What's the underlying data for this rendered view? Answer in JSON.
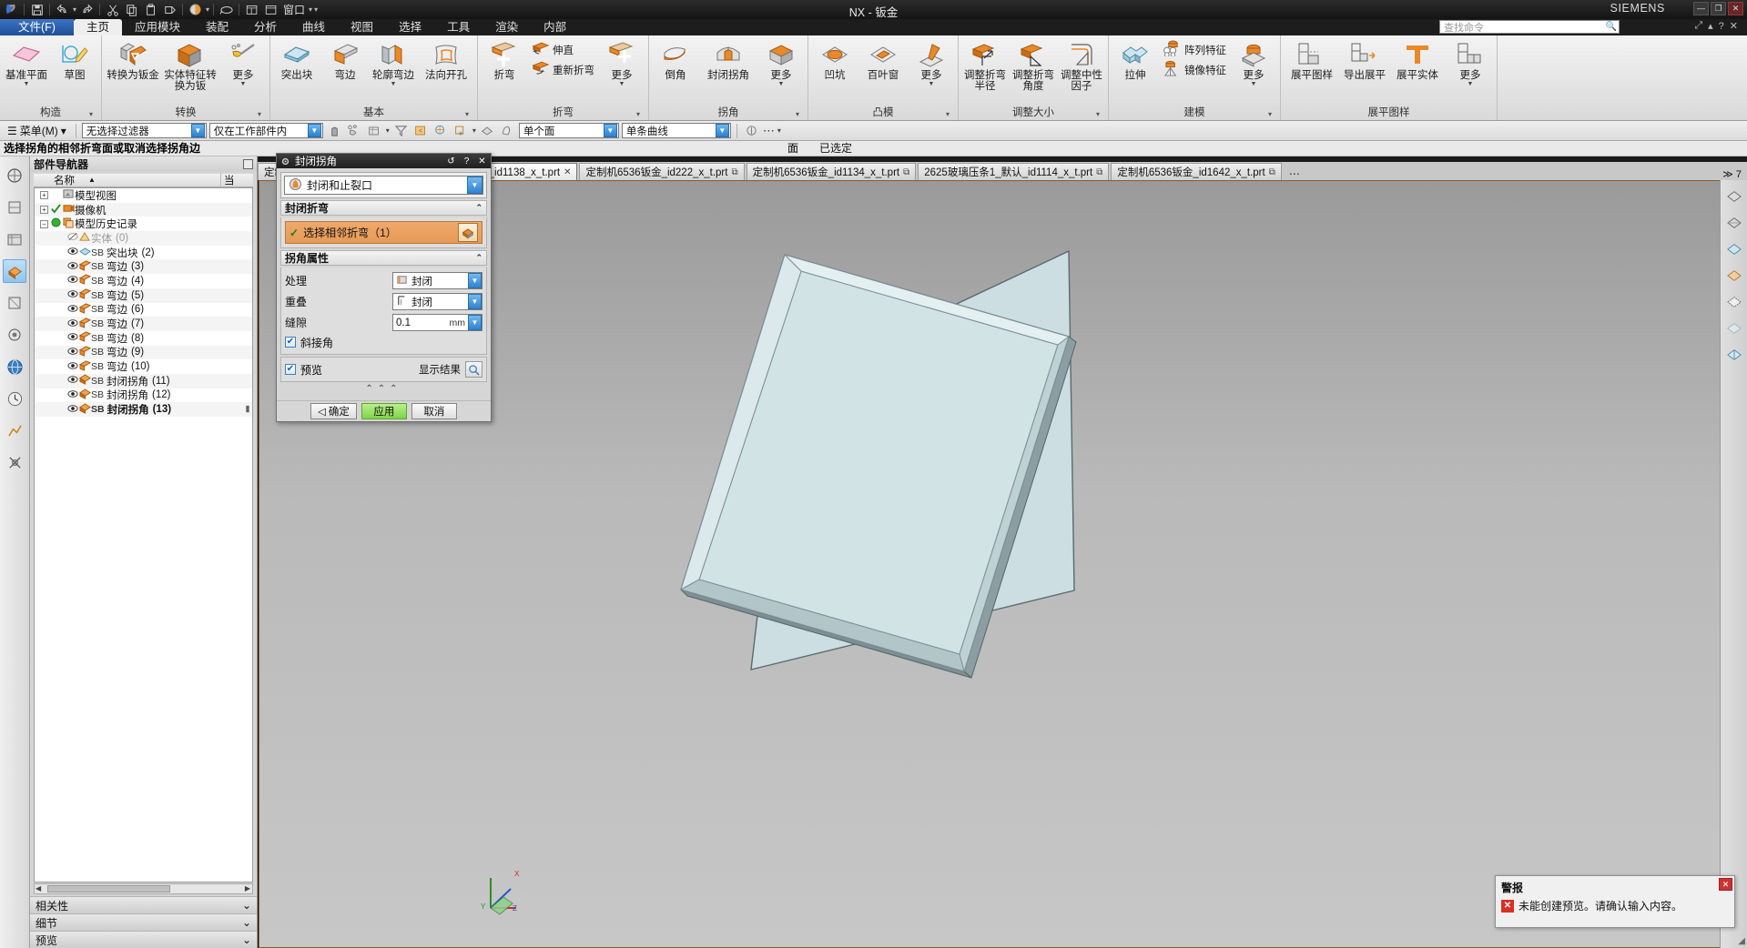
{
  "titlebar": {
    "title": "NX - 钣金",
    "brand": "SIEMENS",
    "min": "—",
    "max": "❐",
    "close": "✕"
  },
  "quick_access": {
    "window_label": "窗口",
    "caret": "▾",
    "more": "▾"
  },
  "search": {
    "placeholder": "查找命令"
  },
  "ribbon_tabs": [
    {
      "label": "文件(F)",
      "state": "file"
    },
    {
      "label": "主页",
      "state": "active"
    },
    {
      "label": "应用模块",
      "state": "normal"
    },
    {
      "label": "装配",
      "state": "normal"
    },
    {
      "label": "分析",
      "state": "normal"
    },
    {
      "label": "曲线",
      "state": "normal"
    },
    {
      "label": "视图",
      "state": "normal"
    },
    {
      "label": "选择",
      "state": "normal"
    },
    {
      "label": "工具",
      "state": "normal"
    },
    {
      "label": "渲染",
      "state": "normal"
    },
    {
      "label": "内部",
      "state": "normal"
    }
  ],
  "ribbon_groups": [
    {
      "label": "构造",
      "items": [
        {
          "label": "基准平面",
          "icon": "datum-plane-icon",
          "dropdown": true
        },
        {
          "label": "草图",
          "icon": "sketch-icon",
          "dropdown": false
        }
      ]
    },
    {
      "label": "转换",
      "items": [
        {
          "label": "转换为钣金",
          "icon": "convert-sheetmetal-icon",
          "dropdown": false
        },
        {
          "label": "实体特征转换为钣",
          "icon": "solid-to-sheet-icon",
          "dropdown": false
        },
        {
          "label": "更多",
          "icon": "more-icon",
          "dropdown": true
        }
      ]
    },
    {
      "label": "基本",
      "items": [
        {
          "label": "突出块",
          "icon": "tab-icon",
          "dropdown": false
        },
        {
          "label": "弯边",
          "icon": "flange-icon",
          "dropdown": false
        },
        {
          "label": "轮廓弯边",
          "icon": "contour-flange-icon",
          "dropdown": true
        },
        {
          "label": "法向开孔",
          "icon": "normal-cutout-icon",
          "dropdown": false
        }
      ]
    },
    {
      "label": "折弯",
      "items": [
        {
          "label": "折弯",
          "icon": "bend-icon",
          "dropdown": false
        },
        {
          "label": "伸直",
          "icon": "unbend-icon",
          "dropdown": false
        },
        {
          "label": "重新折弯",
          "icon": "rebend-icon",
          "dropdown": false
        },
        {
          "label": "更多",
          "icon": "more-icon",
          "dropdown": true
        }
      ]
    },
    {
      "label": "拐角",
      "items": [
        {
          "label": "倒角",
          "icon": "chamfer-icon",
          "dropdown": false
        },
        {
          "label": "封闭拐角",
          "icon": "closed-corner-icon",
          "dropdown": false
        },
        {
          "label": "更多",
          "icon": "more-icon",
          "dropdown": true
        }
      ]
    },
    {
      "label": "凸模",
      "items": [
        {
          "label": "凹坑",
          "icon": "dimple-icon",
          "dropdown": false
        },
        {
          "label": "百叶窗",
          "icon": "louver-icon",
          "dropdown": false
        },
        {
          "label": "更多",
          "icon": "more-icon",
          "dropdown": true
        }
      ]
    },
    {
      "label": "调整大小",
      "items": [
        {
          "label": "调整折弯半径",
          "icon": "resize-bend-radius-icon",
          "dropdown": false
        },
        {
          "label": "调整折弯角度",
          "icon": "resize-bend-angle-icon",
          "dropdown": false
        },
        {
          "label": "调整中性因子",
          "icon": "resize-neutral-factor-icon",
          "dropdown": false
        }
      ]
    },
    {
      "label": "建模",
      "items": [
        {
          "label": "拉伸",
          "icon": "extrude-icon",
          "dropdown": false
        },
        {
          "label": "阵列特征",
          "icon": "pattern-feature-icon",
          "dropdown": false
        },
        {
          "label": "镜像特征",
          "icon": "mirror-feature-icon",
          "dropdown": false
        },
        {
          "label": "更多",
          "icon": "more-icon",
          "dropdown": true
        }
      ]
    },
    {
      "label": "展平图样",
      "items": [
        {
          "label": "展平图样",
          "icon": "flat-pattern-icon",
          "dropdown": false
        },
        {
          "label": "导出展平",
          "icon": "export-flat-icon",
          "dropdown": false
        },
        {
          "label": "展平实体",
          "icon": "flat-solid-icon",
          "dropdown": false
        },
        {
          "label": "更多",
          "icon": "more-icon",
          "dropdown": true
        }
      ]
    }
  ],
  "selection_bar": {
    "menu_label": "菜单(M)",
    "menu_caret": "▾",
    "filter_value": "无选择过滤器",
    "scope_value": "仅在工作部件内",
    "face_rule_value": "单个面",
    "curve_rule_value": "单条曲线",
    "more": "⋯",
    "caret": "▾"
  },
  "cue_line": {
    "text": "选择拐角的相邻折弯面或取消选择拐角边",
    "status_label": "面",
    "status_value": "已选定"
  },
  "doc_tabs": [
    {
      "label": "定制机6536钣金_x_t.prt",
      "active": false,
      "pin": "⧉"
    },
    {
      "label": "定制机6536钣金_id1138_x_t.prt",
      "active": true,
      "close": "✕"
    },
    {
      "label": "定制机6536钣金_id222_x_t.prt",
      "active": false,
      "pin": "⧉"
    },
    {
      "label": "定制机6536钣金_id1134_x_t.prt",
      "active": false,
      "pin": "⧉"
    },
    {
      "label": "2625玻璃压条1_默认_id1114_x_t.prt",
      "active": false,
      "pin": "⧉"
    },
    {
      "label": "定制机6536钣金_id1642_x_t.prt",
      "active": false,
      "pin": "⧉"
    }
  ],
  "doc_tabs_more": "⋯",
  "doc_tabs_count": "≫ 7",
  "part_navigator": {
    "title": "部件导航器",
    "columns": {
      "name": "名称",
      "extra": "当"
    },
    "sort_arrow": "▲",
    "rows": [
      {
        "indent": 0,
        "expander": "+",
        "icon": "model-view-icon",
        "check": "",
        "prefix": "",
        "label": "模型视图",
        "count": "",
        "dim": false,
        "bold": false
      },
      {
        "indent": 0,
        "expander": "+",
        "icon": "camera-icon",
        "check": "✓",
        "prefix": "",
        "label": "摄像机",
        "count": "",
        "dim": false,
        "bold": false
      },
      {
        "indent": 0,
        "expander": "−",
        "icon": "history-icon",
        "check": "●",
        "prefix": "",
        "label": "模型历史记录",
        "count": "",
        "dim": false,
        "bold": false
      },
      {
        "indent": 1,
        "expander": "",
        "icon": "hidden-body-icon",
        "check": "",
        "prefix": "",
        "label": "实体",
        "count": "(0)",
        "dim": true,
        "bold": false
      },
      {
        "indent": 1,
        "expander": "",
        "icon": "tab-feature-icon",
        "check": "",
        "prefix": "SB",
        "label": "突出块",
        "count": "(2)",
        "dim": false,
        "bold": false
      },
      {
        "indent": 1,
        "expander": "",
        "icon": "flange-feature-icon",
        "check": "",
        "prefix": "SB",
        "label": "弯边",
        "count": "(3)",
        "dim": false,
        "bold": false
      },
      {
        "indent": 1,
        "expander": "",
        "icon": "flange-feature-icon",
        "check": "",
        "prefix": "SB",
        "label": "弯边",
        "count": "(4)",
        "dim": false,
        "bold": false
      },
      {
        "indent": 1,
        "expander": "",
        "icon": "flange-feature-icon",
        "check": "",
        "prefix": "SB",
        "label": "弯边",
        "count": "(5)",
        "dim": false,
        "bold": false
      },
      {
        "indent": 1,
        "expander": "",
        "icon": "flange-feature-icon",
        "check": "",
        "prefix": "SB",
        "label": "弯边",
        "count": "(6)",
        "dim": false,
        "bold": false
      },
      {
        "indent": 1,
        "expander": "",
        "icon": "flange-feature-icon",
        "check": "",
        "prefix": "SB",
        "label": "弯边",
        "count": "(7)",
        "dim": false,
        "bold": false
      },
      {
        "indent": 1,
        "expander": "",
        "icon": "flange-feature-icon",
        "check": "",
        "prefix": "SB",
        "label": "弯边",
        "count": "(8)",
        "dim": false,
        "bold": false
      },
      {
        "indent": 1,
        "expander": "",
        "icon": "flange-feature-icon",
        "check": "",
        "prefix": "SB",
        "label": "弯边",
        "count": "(9)",
        "dim": false,
        "bold": false
      },
      {
        "indent": 1,
        "expander": "",
        "icon": "flange-feature-icon",
        "check": "",
        "prefix": "SB",
        "label": "弯边",
        "count": "(10)",
        "dim": false,
        "bold": false
      },
      {
        "indent": 1,
        "expander": "",
        "icon": "closed-corner-feature-icon",
        "check": "",
        "prefix": "SB",
        "label": "封闭拐角",
        "count": "(11)",
        "dim": false,
        "bold": false
      },
      {
        "indent": 1,
        "expander": "",
        "icon": "closed-corner-feature-icon",
        "check": "",
        "prefix": "SB",
        "label": "封闭拐角",
        "count": "(12)",
        "dim": false,
        "bold": false
      },
      {
        "indent": 1,
        "expander": "",
        "icon": "closed-corner-feature-icon",
        "check": "",
        "prefix": "SB",
        "label": "封闭拐角",
        "count": "(13)",
        "dim": false,
        "bold": true
      }
    ],
    "sections": [
      {
        "label": "相关性",
        "chev": "⌄"
      },
      {
        "label": "细节",
        "chev": "⌄"
      },
      {
        "label": "预览",
        "chev": "⌄"
      }
    ]
  },
  "dialog": {
    "title": "封闭拐角",
    "title_icon": "gear-icon",
    "buttons": {
      "reset": "↺",
      "help": "?",
      "close": "✕"
    },
    "type_value": "封闭和止裂口",
    "section_bend": {
      "label": "封闭折弯",
      "chev": "⌃"
    },
    "select_bend": {
      "label": "选择相邻折弯（1）",
      "check": "✓",
      "icon": "select-bend-icon"
    },
    "section_corner": {
      "label": "拐角属性",
      "chev": "⌃"
    },
    "properties": [
      {
        "label": "处理",
        "type": "combo",
        "value": "封闭",
        "icon": "treatment-icon"
      },
      {
        "label": "重叠",
        "type": "combo",
        "value": "封闭",
        "icon": "overlap-icon"
      },
      {
        "label": "缝隙",
        "type": "number",
        "value": "0.1",
        "unit": "mm"
      }
    ],
    "miter": {
      "label": "斜接角",
      "checked": true
    },
    "preview": {
      "label": "预览",
      "checked": true,
      "show_result": "显示结果",
      "magnifier_icon": "magnifier-icon"
    },
    "chevrons": "⌃⌃⌃",
    "footer": {
      "ok": "确定",
      "ok_icon": "◁",
      "apply": "应用",
      "cancel": "取消"
    }
  },
  "alert": {
    "title": "警报",
    "message": "未能创建预览。请确认输入内容。",
    "icon": "error-icon",
    "close": "✕"
  },
  "colors": {
    "accent_orange": "#e8992f",
    "apply_green": "#7fd44a",
    "file_tab_blue": "#2f6fbf",
    "error_red": "#d93025",
    "part_face": "#cfe0e3"
  },
  "triad": {
    "x": "X",
    "y": "Y",
    "z": "Z"
  }
}
